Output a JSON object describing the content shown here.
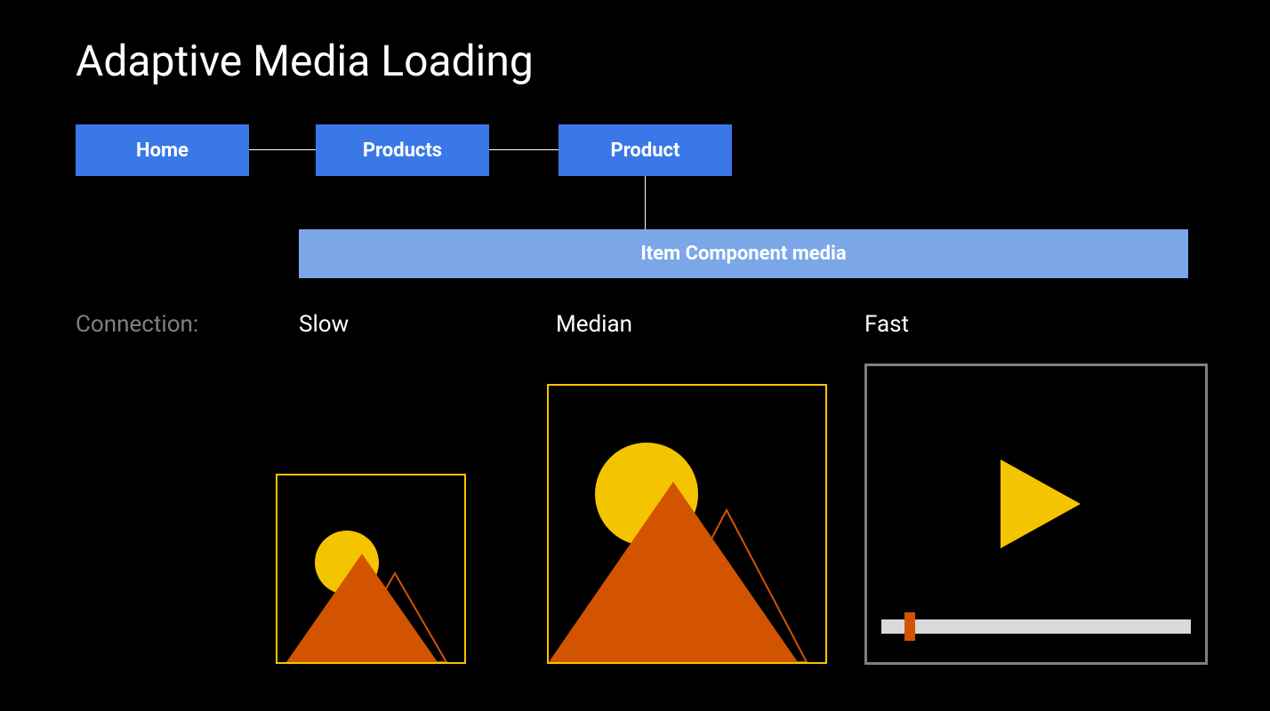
{
  "title": "Adaptive Media Loading",
  "nav": {
    "home": "Home",
    "products": "Products",
    "product": "Product"
  },
  "item_component": "Item Component media",
  "connection_label": "Connection:",
  "speeds": {
    "slow": "Slow",
    "median": "Median",
    "fast": "Fast"
  },
  "colors": {
    "background": "#000000",
    "nav_primary": "#3b78e7",
    "nav_secondary": "#7ba7e8",
    "yellow": "#f5c400",
    "orange": "#d35400",
    "gray": "#808080",
    "light_gray": "#d9d9d9",
    "white": "#ffffff"
  },
  "media_variants": {
    "slow": "low-res-image",
    "median": "high-res-image",
    "fast": "video"
  }
}
